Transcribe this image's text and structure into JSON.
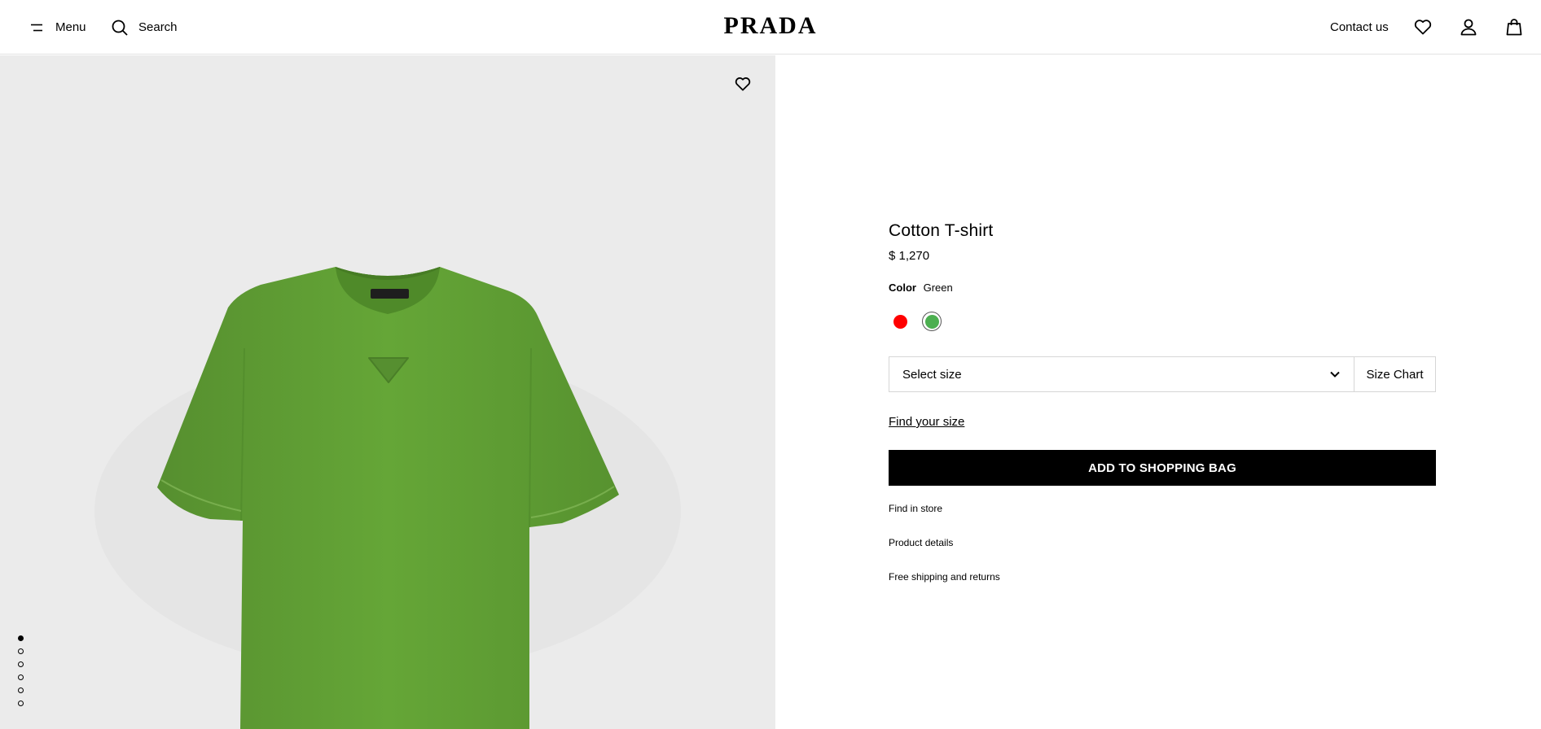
{
  "header": {
    "menu_label": "Menu",
    "search_label": "Search",
    "logo": "PRADA",
    "contact_label": "Contact us",
    "icons": [
      "menu-icon",
      "search-icon",
      "heart-icon",
      "user-icon",
      "bag-icon"
    ]
  },
  "gallery": {
    "active_index": 0,
    "slide_count": 6,
    "wishlist_icon": "heart-icon"
  },
  "product": {
    "title": "Cotton T-shirt",
    "price": "$ 1,270",
    "color_label": "Color",
    "color_value": "Green",
    "swatches": [
      {
        "name": "Red",
        "color": "#ff0000",
        "selected": false
      },
      {
        "name": "Green",
        "color": "#4caf50",
        "selected": true
      }
    ],
    "size_placeholder": "Select size",
    "size_chart_label": "Size Chart",
    "find_size_label": "Find your size",
    "add_to_bag_label": "ADD TO SHOPPING BAG",
    "links": [
      "Find in store",
      "Product details",
      "Free shipping and returns"
    ]
  },
  "colors": {
    "shirt": "#5e9e34",
    "background": "#ebebeb",
    "button": "#000000"
  }
}
